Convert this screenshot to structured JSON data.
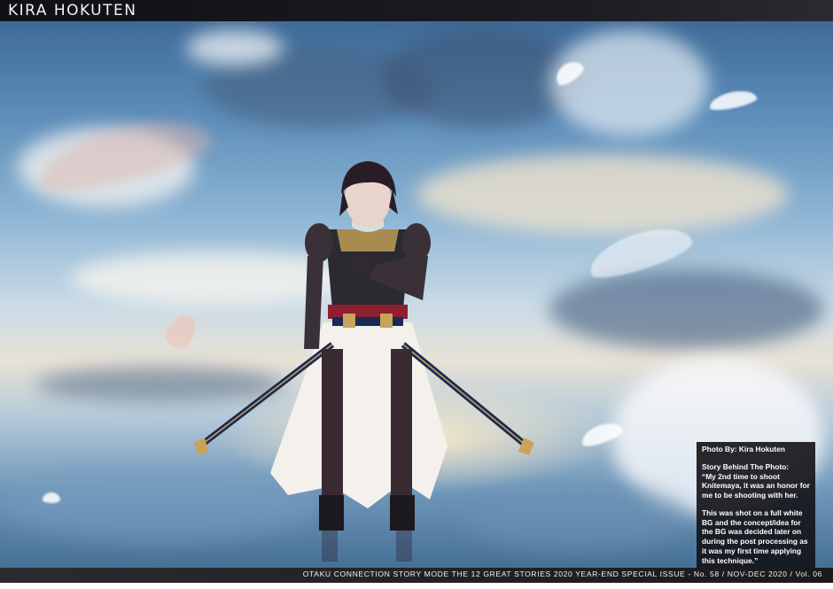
{
  "header": {
    "title": "KIRA HOKUTEN"
  },
  "photo": {
    "subject": "cosplayer-photo"
  },
  "credit": {
    "photo_by": "Photo By: Kira Hokuten",
    "story_heading": "Story Behind The Photo:",
    "quote_part1": "“My 2nd time to shoot Knitemaya, it was an honor for me to be shooting with her.",
    "quote_part2": "This was shot on a full white BG and the concept/idea for the BG was decided later on during the post processing as it was my first time applying this technique.”"
  },
  "footer": {
    "text": "OTAKU CONNECTION STORY MODE THE 12 GREAT STORIES 2020 YEAR-END SPECIAL ISSUE - No. 58 / NOV-DEC 2020 / Vol. 06"
  },
  "colors": {
    "bar": "#141418",
    "sky_top": "#3e6a98",
    "horizon": "#e8e2d6"
  }
}
